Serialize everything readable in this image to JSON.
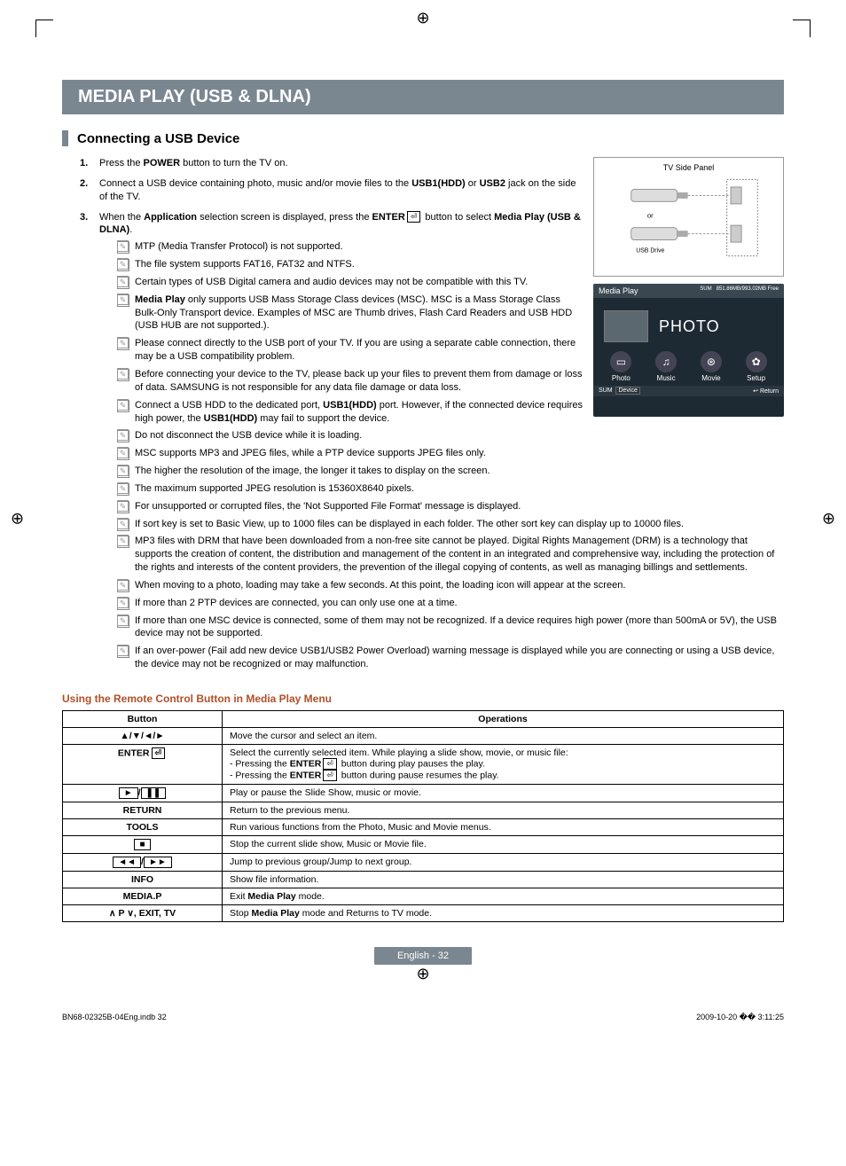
{
  "title_bar": "MEDIA PLAY (USB & DLNA)",
  "section_heading": "Connecting a USB Device",
  "panel": {
    "title": "TV Side Panel",
    "or": "or",
    "usb_drive": "USB Drive"
  },
  "mediaplay": {
    "header_left": "Media Play",
    "header_sum": "SUM",
    "header_right": "851.86MB/993.02MB Free",
    "photo_label": "PHOTO",
    "icons": [
      {
        "label": "Photo",
        "glyph": "▭"
      },
      {
        "label": "Music",
        "glyph": "♫"
      },
      {
        "label": "Movie",
        "glyph": "⊛"
      },
      {
        "label": "Setup",
        "glyph": "✿"
      }
    ],
    "foot_left_sum": "SUM",
    "foot_left_device": "Device",
    "foot_right": "Return"
  },
  "steps": [
    {
      "n": "1.",
      "html": "Press the <b>POWER</b> button to turn the TV on."
    },
    {
      "n": "2.",
      "html": "Connect a USB device containing photo, music and/or movie files to the <b>USB1(HDD)</b> or <b>USB2</b> jack on the side of the TV."
    },
    {
      "n": "3.",
      "html": "When the <b>Application</b> selection screen is displayed, press the <b>ENTER</b><span class='enter-icon'>⏎</span> button to select <b>Media Play (USB & DLNA)</b>."
    }
  ],
  "notes_group1": [
    "MTP (Media Transfer Protocol) is not supported.",
    "The file system supports FAT16, FAT32 and NTFS.",
    "Certain types of USB Digital camera and audio devices may not be compatible with this TV.",
    "<b>Media Play</b> only supports USB Mass Storage Class devices (MSC). MSC is a Mass Storage Class Bulk-Only Transport device. Examples of MSC are Thumb drives, Flash Card Readers and USB HDD (USB HUB are not supported.).",
    "Please connect directly to the USB port of your TV. If you are using a separate cable connection, there may be a USB compatibility problem.",
    "Before connecting your device to the TV, please back up your files to prevent them from damage or loss of data. SAMSUNG is not responsible for any data file damage or data loss.",
    "Connect a USB HDD to the dedicated port, <b>USB1(HDD)</b> port. However, if the connected device requires high power, the <b>USB1(HDD)</b> may fail to support the device.",
    "Do not disconnect the USB device while it is loading.",
    "MSC supports MP3 and JPEG files, while a PTP device supports JPEG files only.",
    "The higher the resolution of the image, the longer it takes to display on the screen.",
    "The maximum supported JPEG resolution is 15360X8640 pixels.",
    "For unsupported or corrupted files, the 'Not Supported File Format' message is displayed.",
    "If sort key is set to Basic View, up to 1000 files can be displayed in each folder. The other sort key can display up to 10000 files.",
    "MP3 files with DRM that have been downloaded from a non-free site cannot be played. Digital Rights Management (DRM) is a technology that supports the creation of content, the distribution and management of the content in an integrated and comprehensive way, including the protection of the rights and interests of the content providers, the prevention of the illegal copying of contents, as well as managing billings and settlements.",
    "When moving to a photo, loading may take a few seconds. At this point, the loading icon will appear at the screen.",
    "If more than 2 PTP devices are connected, you can only use one at a time.",
    "If more than one MSC device is connected, some of them may not be recognized. If a device requires high power (more than 500mA or 5V), the USB device may not be supported.",
    "If an over-power (Fail add new device USB1/USB2 Power Overload) warning message is displayed while you are connecting or using a USB device, the device may not be recognized or may malfunction."
  ],
  "subheading": "Using the Remote Control Button in Media Play Menu",
  "table": {
    "headers": [
      "Button",
      "Operations"
    ],
    "rows": [
      {
        "btn_html": "▲/▼/◄/►",
        "op_html": "Move the cursor and select an item."
      },
      {
        "btn_html": "ENTER<span class='enter-icon'>⏎</span>",
        "op_html": "Select the currently selected item. While playing a slide show, movie, or music file:<br>- Pressing the <b>ENTER</b><span class='enter-icon'>⏎</span> button during play pauses the play.<br>- Pressing the <b>ENTER</b><span class='enter-icon'>⏎</span> button during pause resumes the play."
      },
      {
        "btn_html": "<span class='btn-box'>►</span>/<span class='btn-box'>❚❚</span>",
        "op_html": "Play or pause the Slide Show, music or movie."
      },
      {
        "btn_html": "RETURN",
        "op_html": "Return to the previous menu."
      },
      {
        "btn_html": "TOOLS",
        "op_html": "Run various functions from the Photo, Music and Movie menus."
      },
      {
        "btn_html": "<span class='btn-box'>■</span>",
        "op_html": "Stop the current slide show, Music or Movie file."
      },
      {
        "btn_html": "<span class='btn-box'>◄◄</span>/<span class='btn-box'>►►</span>",
        "op_html": "Jump to previous group/Jump to next group."
      },
      {
        "btn_html": "INFO",
        "op_html": "Show file information."
      },
      {
        "btn_html": "MEDIA.P",
        "op_html": "Exit <b>Media Play</b> mode."
      },
      {
        "btn_html": "∧ P ∨, EXIT, TV",
        "op_html": "Stop <b>Media Play</b> mode and Returns to TV mode."
      }
    ]
  },
  "page_number": "English - 32",
  "footer": {
    "left": "BN68-02325B-04Eng.indb   32",
    "right": "2009-10-20   �� 3:11:25"
  }
}
